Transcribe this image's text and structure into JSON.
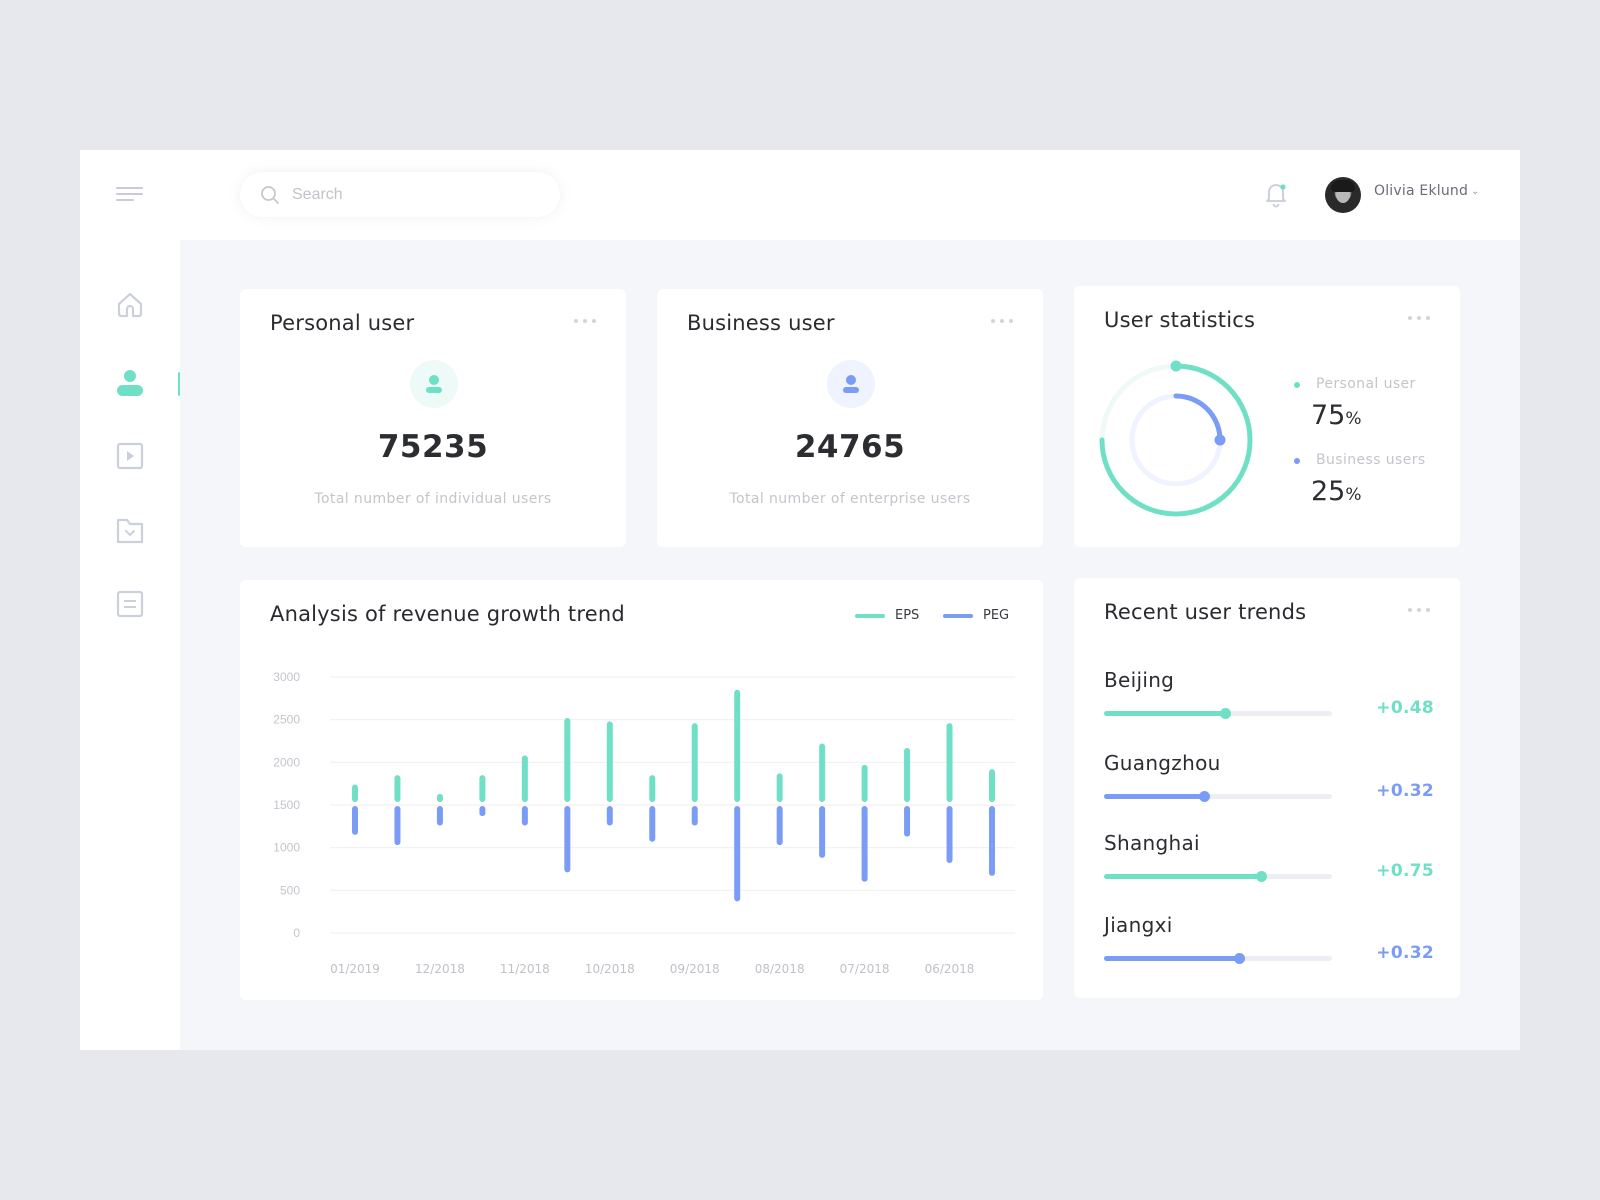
{
  "colors": {
    "green": "#6fe0c5",
    "blue": "#7b9cf5",
    "green_light": "#eefaf7",
    "blue_light": "#eef3fd"
  },
  "header": {
    "menu_icon": "hamburger-menu-icon",
    "search": {
      "placeholder": "Search",
      "value": "",
      "icon": "search-icon"
    },
    "notification_icon": "bell-icon",
    "user": {
      "name": "Olivia Eklund",
      "chevron": "⌄"
    }
  },
  "sidebar": {
    "items": [
      {
        "icon": "home-icon",
        "active": false
      },
      {
        "icon": "user-icon",
        "active": true
      },
      {
        "icon": "video-icon",
        "active": false
      },
      {
        "icon": "folder-icon",
        "active": false
      },
      {
        "icon": "document-icon",
        "active": false
      }
    ]
  },
  "personal_card": {
    "title": "Personal user",
    "value": "75235",
    "caption": "Total number of individual users"
  },
  "business_card": {
    "title": "Business user",
    "value": "24765",
    "caption": "Total number of enterprise users"
  },
  "stats_card": {
    "title": "User statistics",
    "items": [
      {
        "label": "Personal user",
        "value": "75",
        "unit": "%",
        "percent": 75
      },
      {
        "label": "Business users",
        "value": "25",
        "unit": "%",
        "percent": 25
      }
    ]
  },
  "chart_card": {
    "title": "Analysis of revenue growth trend",
    "legend": [
      "EPS",
      "PEG"
    ]
  },
  "chart_data": {
    "type": "bar",
    "title": "Analysis of revenue growth trend",
    "baseline": 1500,
    "ylim": [
      0,
      3000
    ],
    "yticks": [
      0,
      500,
      1000,
      1500,
      2000,
      2500,
      3000
    ],
    "grid": true,
    "legend_position": "top-right",
    "xlabel": "",
    "ylabel": "",
    "categories": [
      "01/2019",
      "12/2018",
      "11/2018",
      "10/2018",
      "09/2018",
      "08/2018",
      "07/2018",
      "06/2018"
    ],
    "series": [
      {
        "name": "EPS",
        "color": "#6fe0c5",
        "values": [
          1740,
          1850,
          1630,
          1850,
          2080,
          2520,
          2480,
          1850,
          2460,
          2850,
          1870,
          2220,
          1970,
          2170,
          2460,
          1920
        ]
      },
      {
        "name": "PEG",
        "color": "#7b9cf5",
        "values": [
          1150,
          1030,
          1260,
          1370,
          1260,
          710,
          1260,
          1070,
          1260,
          370,
          1030,
          880,
          600,
          1130,
          820,
          670
        ]
      }
    ]
  },
  "trends_card": {
    "title": "Recent user trends",
    "items": [
      {
        "city": "Beijing",
        "delta": "+0.48",
        "progress": 0.53,
        "color": "green"
      },
      {
        "city": "Guangzhou",
        "delta": "+0.32",
        "progress": 0.44,
        "color": "blue"
      },
      {
        "city": "Shanghai",
        "delta": "+0.75",
        "progress": 0.69,
        "color": "green"
      },
      {
        "city": "Jiangxi",
        "delta": "+0.32",
        "progress": 0.59,
        "color": "blue"
      }
    ]
  }
}
